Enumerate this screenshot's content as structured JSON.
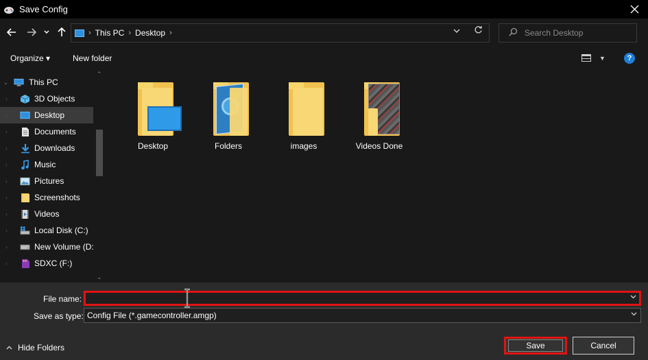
{
  "window": {
    "title": "Save Config",
    "close_glyph": "✕"
  },
  "nav": {
    "back_glyph": "🡐",
    "forward_glyph": "→",
    "recent_glyph": "⌄",
    "up_glyph": "↑",
    "breadcrumb": [
      "This PC",
      "Desktop"
    ],
    "search_placeholder": "Search Desktop"
  },
  "commands": {
    "organize": "Organize ▾",
    "new_folder": "New folder",
    "help": "?"
  },
  "sidebar": {
    "items": [
      {
        "label": "This PC",
        "icon": "pc-icon"
      },
      {
        "label": "3D Objects",
        "icon": "cube-icon"
      },
      {
        "label": "Desktop",
        "icon": "desktop-icon",
        "selected": true
      },
      {
        "label": "Documents",
        "icon": "document-icon"
      },
      {
        "label": "Downloads",
        "icon": "download-icon"
      },
      {
        "label": "Music",
        "icon": "music-icon"
      },
      {
        "label": "Pictures",
        "icon": "pictures-icon"
      },
      {
        "label": "Screenshots",
        "icon": "folder-icon"
      },
      {
        "label": "Videos",
        "icon": "video-icon"
      },
      {
        "label": "Local Disk (C:)",
        "icon": "drive-icon"
      },
      {
        "label": "New Volume (D:",
        "icon": "drive-icon"
      },
      {
        "label": "SDXC (F:)",
        "icon": "sd-card-icon"
      }
    ]
  },
  "files": [
    {
      "label": "Desktop",
      "icon": "folder-desktop-icon"
    },
    {
      "label": "Folders",
      "icon": "folder-media-icon"
    },
    {
      "label": "images",
      "icon": "folder-icon"
    },
    {
      "label": "Videos Done",
      "icon": "folder-thumbnail-icon"
    }
  ],
  "form": {
    "file_name_label": "File name:",
    "file_name_value": "",
    "save_as_type_label": "Save as type:",
    "save_as_type_value": "Config File (*.gamecontroller.amgp)",
    "hide_folders": "Hide Folders",
    "save": "Save",
    "cancel": "Cancel"
  },
  "colors": {
    "accent": "#1e7fd9",
    "highlight_border": "#e21313",
    "folder": "#f2c14f"
  }
}
